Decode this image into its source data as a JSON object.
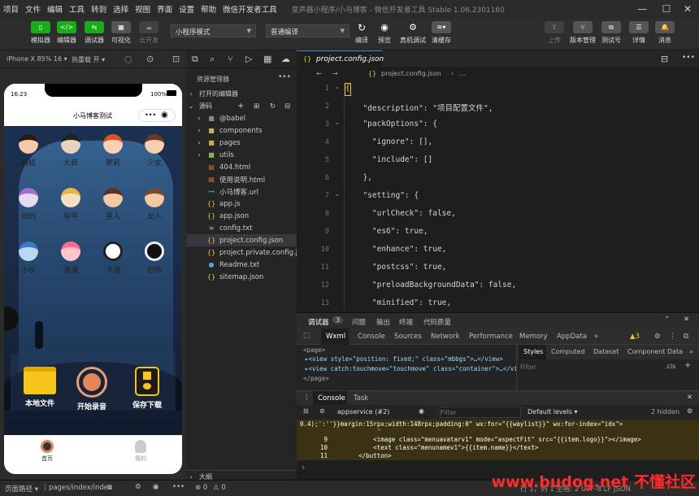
{
  "menu": {
    "items": [
      "项目",
      "文件",
      "编辑",
      "工具",
      "转到",
      "选择",
      "视图",
      "界面",
      "设置",
      "帮助",
      "微信开发者工具"
    ],
    "title": "变声器小程序/小马博客 - 微信开发者工具 Stable 1.06.2301160",
    "window": {
      "minimize": "—",
      "maximize": "☐",
      "close": "✕"
    }
  },
  "toolbar": {
    "left": [
      {
        "icon": "phone-icon",
        "label": "模拟器"
      },
      {
        "icon": "code-icon",
        "label": "编辑器"
      },
      {
        "icon": "debug-icon",
        "label": "调试器"
      },
      {
        "icon": "visual-icon",
        "label": "可视化"
      },
      {
        "icon": "cloud-icon",
        "label": "云开发"
      }
    ],
    "mode_select": "小程序模式",
    "compile_select": "普通编译",
    "mid": [
      {
        "icon": "compile-icon",
        "label": "编译"
      },
      {
        "icon": "preview-icon",
        "label": "预览"
      },
      {
        "icon": "real-debug-icon",
        "label": "真机调试"
      },
      {
        "icon": "cache-icon",
        "label": "清缓存"
      }
    ],
    "right": [
      {
        "icon": "upload-icon",
        "label": "上传"
      },
      {
        "icon": "version-icon",
        "label": "版本管理"
      },
      {
        "icon": "testid-icon",
        "label": "测试号"
      },
      {
        "icon": "detail-icon",
        "label": "详情"
      },
      {
        "icon": "message-icon",
        "label": "消息"
      }
    ]
  },
  "simulator": {
    "device": "iPhone X 85% 16 ▾",
    "hot_reload": "热重载 开 ▾",
    "time": "16:23",
    "battery": "100%",
    "nav_title": "小马博客测试",
    "capsule_more": "•••",
    "capsule_close": "◉",
    "avatars": [
      {
        "name": "萌娃",
        "color": "#f6c8a8",
        "hair": "#2b1a10"
      },
      {
        "name": "大叔",
        "color": "#e9d2bf",
        "hair": "#222"
      },
      {
        "name": "萝莉",
        "color": "#f7d0b5",
        "hair": "#d8551f"
      },
      {
        "name": "少女",
        "color": "#f5cfb0",
        "hair": "#6b3a1e"
      },
      {
        "name": "动的",
        "color": "#e8d8f0",
        "hair": "#a36bd0"
      },
      {
        "name": "导号",
        "color": "#f4e0c0",
        "hair": "#e6b840"
      },
      {
        "name": "男人",
        "color": "#f1c9a5",
        "hair": "#5a3420"
      },
      {
        "name": "女人",
        "color": "#f1c9a5",
        "hair": "#7a4a2a"
      },
      {
        "name": "小伙",
        "color": "#bcd8f0",
        "hair": "#3a78c0"
      },
      {
        "name": "浪漫",
        "color": "#ffc7c7",
        "hair": "#ff6b8a"
      },
      {
        "name": "卡通",
        "color": "#ffffff",
        "hair": "#222"
      },
      {
        "name": "恐怖",
        "color": "#eee",
        "hair": "#111"
      }
    ],
    "actions": [
      {
        "icon": "folder-icon",
        "label": "本地文件"
      },
      {
        "icon": "record-icon",
        "label": "开始录音"
      },
      {
        "icon": "save-icon",
        "label": "保存下载"
      }
    ],
    "tabbar": [
      {
        "icon": "home-icon",
        "label": "首页"
      },
      {
        "icon": "user-icon",
        "label": "我的"
      }
    ]
  },
  "explorer": {
    "title": "资源管理器",
    "more": "•••",
    "open_editors": "打开的编辑器",
    "root": "源码",
    "files": [
      {
        "name": "@babel",
        "type": "folder",
        "color": "#7a8c9e"
      },
      {
        "name": "components",
        "type": "folder",
        "color": "#c7b35c"
      },
      {
        "name": "pages",
        "type": "folder",
        "color": "#d0a84a"
      },
      {
        "name": "utils",
        "type": "folder",
        "color": "#8cb24b"
      },
      {
        "name": "404.html",
        "type": "html",
        "color": "#e06c3c"
      },
      {
        "name": "使用说明.html",
        "type": "html",
        "color": "#e06c3c"
      },
      {
        "name": "小马博客.url",
        "type": "url",
        "color": "#4aa3df"
      },
      {
        "name": "app.js",
        "type": "js",
        "color": "#e8c547"
      },
      {
        "name": "app.json",
        "type": "json",
        "color": "#e8c547"
      },
      {
        "name": "config.txt",
        "type": "txt",
        "color": "#9aa0a6"
      },
      {
        "name": "project.config.json",
        "type": "json",
        "color": "#e8c547"
      },
      {
        "name": "project.private.config.js...",
        "type": "json",
        "color": "#e8c547"
      },
      {
        "name": "Readme.txt",
        "type": "info",
        "color": "#4aa3df"
      },
      {
        "name": "sitemap.json",
        "type": "json",
        "color": "#e8c547"
      }
    ],
    "outline": "大纲"
  },
  "editor": {
    "tab": "project.config.json",
    "breadcrumb": "project.config.json",
    "lines": [
      {
        "n": "1",
        "t": "{"
      },
      {
        "n": "2",
        "t": "  \"description\": \"项目配置文件\","
      },
      {
        "n": "3",
        "t": "  \"packOptions\": {"
      },
      {
        "n": "4",
        "t": "    \"ignore\": [],"
      },
      {
        "n": "5",
        "t": "    \"include\": []"
      },
      {
        "n": "6",
        "t": "  },"
      },
      {
        "n": "7",
        "t": "  \"setting\": {"
      },
      {
        "n": "8",
        "t": "    \"urlCheck\": false,"
      },
      {
        "n": "9",
        "t": "    \"es6\": true,"
      },
      {
        "n": "10",
        "t": "    \"enhance\": true,"
      },
      {
        "n": "11",
        "t": "    \"postcss\": true,"
      },
      {
        "n": "12",
        "t": "    \"preloadBackgroundData\": false,"
      },
      {
        "n": "13",
        "t": "    \"minified\": true,"
      }
    ]
  },
  "devtools": {
    "tabs": [
      {
        "label": "调试器",
        "active": true
      },
      {
        "label": "3",
        "active": false
      },
      {
        "label": "问题",
        "active": false
      },
      {
        "label": "输出",
        "active": false
      },
      {
        "label": "终端",
        "active": false
      },
      {
        "label": "代码质量",
        "active": false
      }
    ],
    "panels": [
      "Wxml",
      "Console",
      "Sources",
      "Network",
      "Performance",
      "Memory",
      "AppData",
      "»"
    ],
    "warn_count": "▲3",
    "elements": [
      "<page>",
      "▸<view style=\"position: fixed;\" class=\"mbbgs\">…</view>",
      "▸<view catch:touchmove=\"touchmove\" class=\"container\">…</view>",
      "</page>"
    ],
    "style_tabs": [
      "Styles",
      "Computed",
      "Dataset",
      "Component Data",
      "»"
    ],
    "filter_placeholder": "Filter",
    "cls": ".cls",
    "plus": "+"
  },
  "console": {
    "tabs": [
      "Console",
      "Task"
    ],
    "context": "appservice (#2)",
    "filter_placeholder": "Filter",
    "levels": "Default levels ▾",
    "hidden": "2 hidden",
    "lines": [
      {
        "n": "",
        "t": "0.4);':''}}margin:15rpx;width:148rpx;padding:0\" wx:for=\"{{waylist}}\" wx:for-index=\"idx\">"
      },
      {
        "n": "",
        "t": "                     ^"
      },
      {
        "n": "9",
        "t": "            <image class=\"menuavatarv1\" mode=\"aspectFit\" src=\"{{item.logo}}\"></image>"
      },
      {
        "n": "10",
        "t": "            <text class=\"menunamev1\">{{item.name}}</text>"
      },
      {
        "n": "11",
        "t": "        </button>"
      }
    ],
    "prompt": "›"
  },
  "status": {
    "path_label": "页面路径 ▾",
    "path": "pages/index/index",
    "errors": "⊗ 0",
    "warnings": "⚠ 0",
    "right": "行 1，列 1  空格: 2  UTF-8  LF  JSON"
  },
  "watermark": "www.budog.net 不懂社区"
}
